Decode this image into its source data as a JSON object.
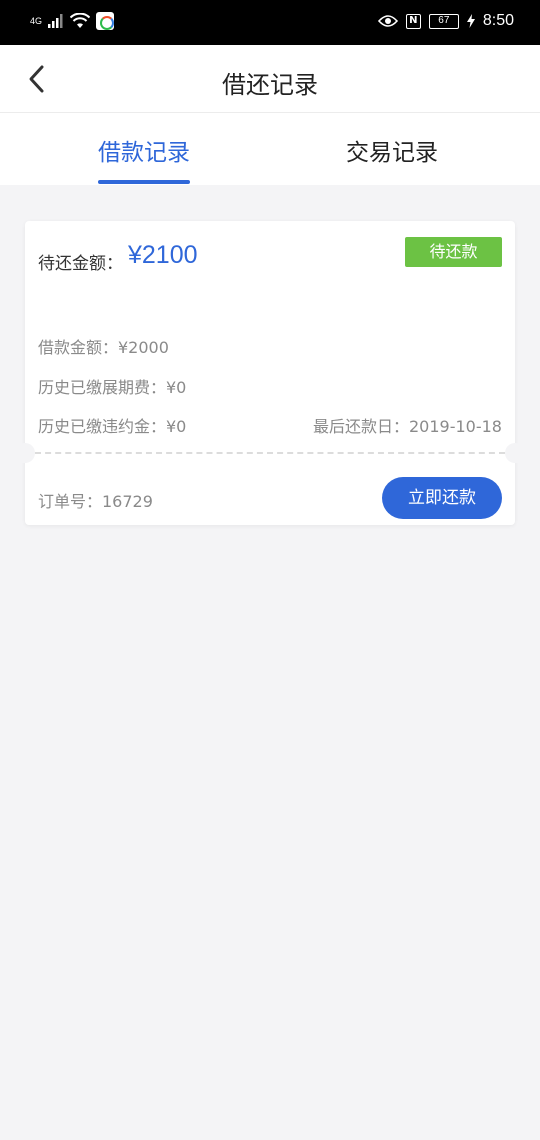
{
  "status_bar": {
    "network": "4G",
    "nfc": "N",
    "battery": "67",
    "time": "8:50"
  },
  "header": {
    "title": "借还记录"
  },
  "tabs": [
    {
      "label": "借款记录",
      "active": true
    },
    {
      "label": "交易记录",
      "active": false
    }
  ],
  "loan_card": {
    "amount_label": "待还金额：",
    "amount_value": "¥2100",
    "status": "待还款",
    "loan_amount": "借款金额：¥2000",
    "extension_fee": "历史已缴展期费：¥0",
    "penalty": "历史已缴违约金：¥0",
    "due_date": "最后还款日：2019-10-18",
    "order_no": "订单号：16729",
    "repay_button": "立即还款"
  },
  "colors": {
    "accent": "#2f67d9",
    "status_green": "#6cc244",
    "background": "#f4f4f6"
  }
}
